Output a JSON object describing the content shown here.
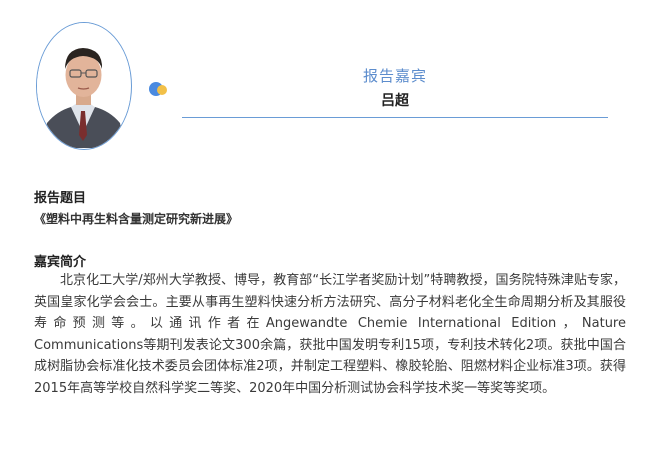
{
  "speaker": {
    "role_title": "报告嘉宾",
    "name": "吕超"
  },
  "topic": {
    "label": "报告题目",
    "title": "《塑料中再生料含量测定研究新进展》"
  },
  "bio": {
    "label": "嘉宾简介",
    "text": "北京化工大学/郑州大学教授、博导，教育部“长江学者奖励计划”特聘教授，国务院特殊津贴专家，英国皇家化学会会士。主要从事再生塑料快速分析方法研究、高分子材料老化全生命周期分析及其服役寿命预测等。以通讯作者在Angewandte Chemie International Edition，Nature Communications等期刊发表论文300余篇，获批中国发明专利15项，专利技术转化2项。获批中国合成树脂协会标准化技术委员会团体标准2项，并制定工程塑料、橡胶轮胎、阻燃材料企业标准3项。获得2015年高等学校自然科学奖二等奖、2020年中国分析测试协会科学技术奖一等奖等奖项。"
  },
  "colors": {
    "accent_blue": "#5d8dcd",
    "ring_blue": "#6a9cd6",
    "dot_blue": "#4a8ae0",
    "dot_yellow": "#f2c048"
  }
}
